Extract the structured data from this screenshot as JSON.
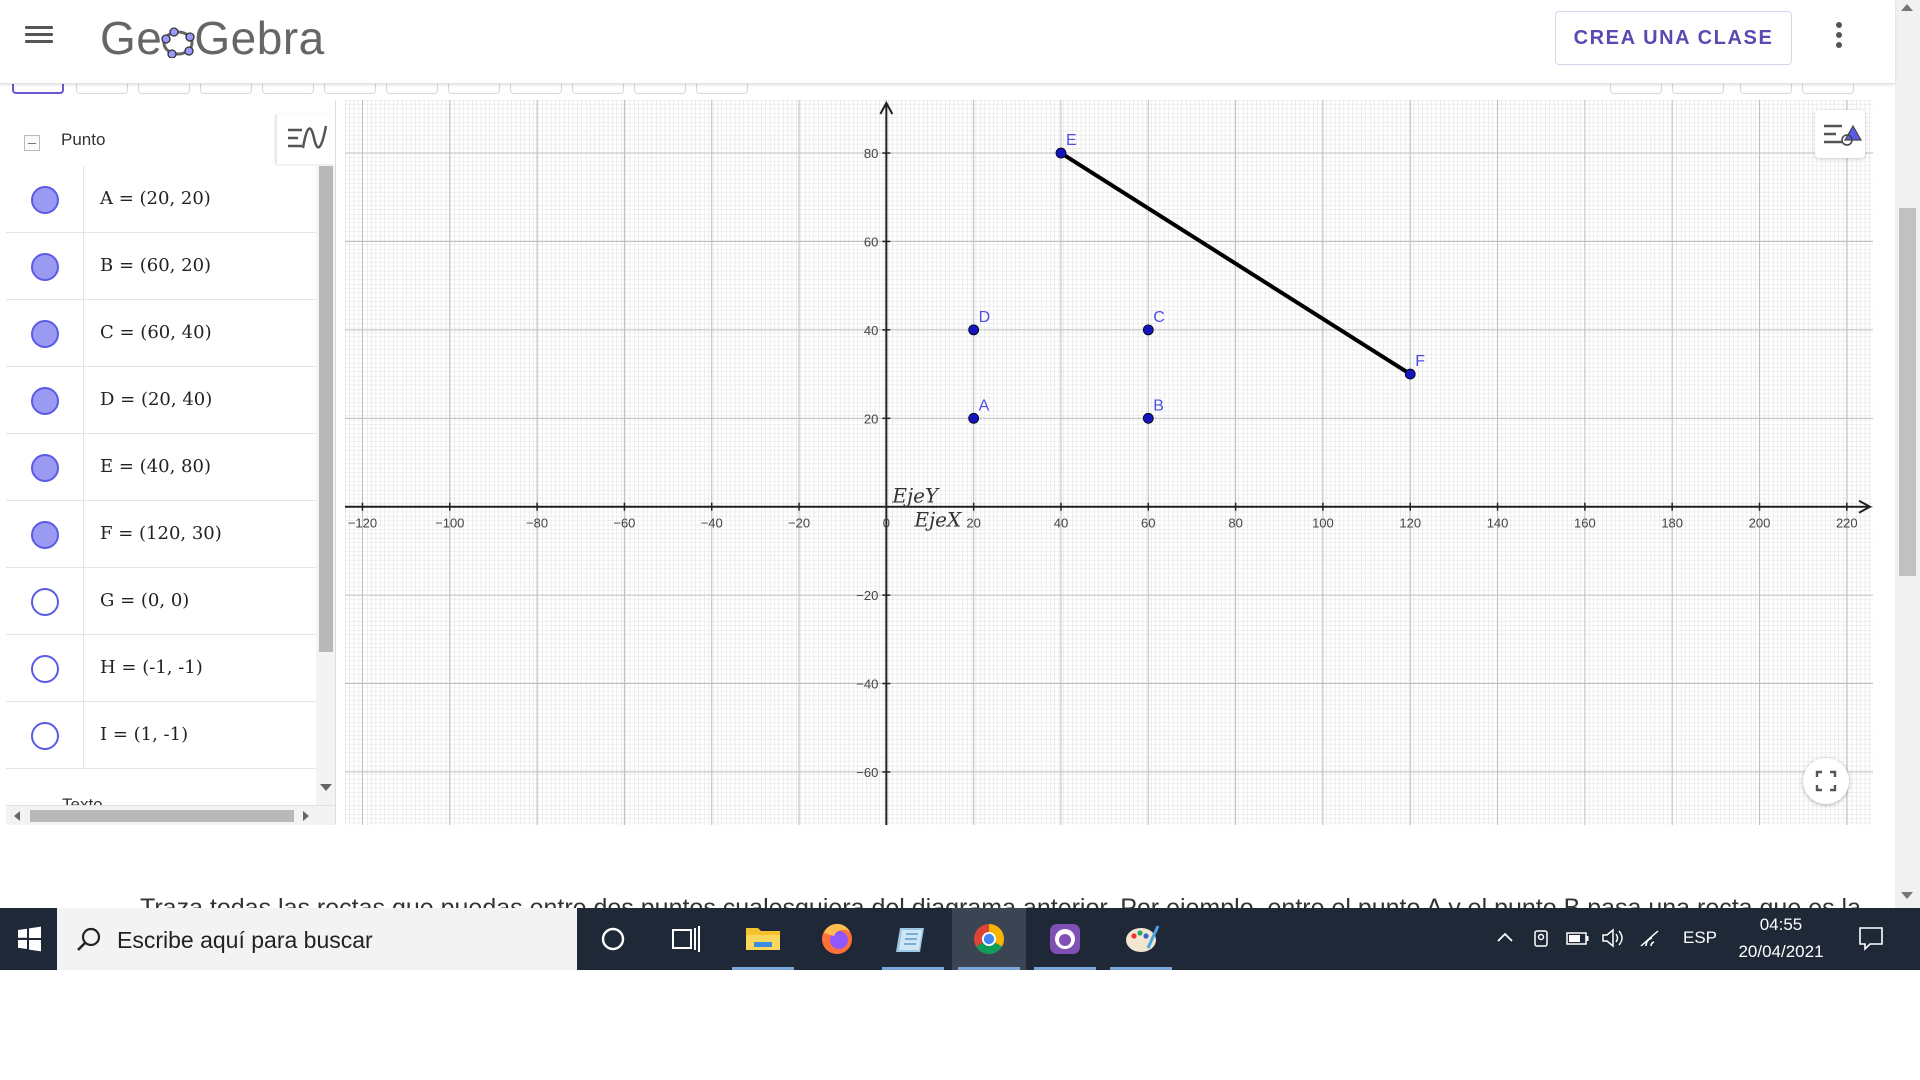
{
  "header": {
    "logo_text": "GeoGebra",
    "logo_prefix": "Ge",
    "logo_suffix": "Gebra",
    "class_button_label": "CREA UNA CLASE",
    "accent_color": "#5b48b1"
  },
  "algebra": {
    "group_label": "Punto",
    "point_color": "#5b5be8",
    "items": [
      {
        "label": "A = (20, 20)",
        "visible": true
      },
      {
        "label": "B = (60, 20)",
        "visible": true
      },
      {
        "label": "C = (60, 40)",
        "visible": true
      },
      {
        "label": "D = (20, 40)",
        "visible": true
      },
      {
        "label": "E = (40, 80)",
        "visible": true
      },
      {
        "label": "F = (120, 30)",
        "visible": true
      },
      {
        "label": "G = (0, 0)",
        "visible": false
      },
      {
        "label": "H = (-1, -1)",
        "visible": false
      },
      {
        "label": "I = (1, -1)",
        "visible": false
      }
    ],
    "next_group_partial": "Texto"
  },
  "graphics": {
    "x_axis_label": "EjeX",
    "y_axis_label": "EjeY",
    "xlim": [
      -124,
      226
    ],
    "ylim": [
      -72,
      92
    ],
    "x_ticks": [
      -120,
      -100,
      -80,
      -60,
      -40,
      -20,
      0,
      20,
      40,
      60,
      80,
      100,
      120,
      140,
      160,
      180,
      200,
      220
    ],
    "y_ticks": [
      -60,
      -40,
      -20,
      20,
      40,
      60,
      80
    ],
    "points": [
      {
        "name": "A",
        "x": 20,
        "y": 20
      },
      {
        "name": "B",
        "x": 60,
        "y": 20
      },
      {
        "name": "C",
        "x": 60,
        "y": 40
      },
      {
        "name": "D",
        "x": 20,
        "y": 40
      },
      {
        "name": "E",
        "x": 40,
        "y": 80
      },
      {
        "name": "F",
        "x": 120,
        "y": 30
      }
    ],
    "segments": [
      {
        "from": "E",
        "to": "F"
      }
    ],
    "point_color": "#1515c0",
    "label_color": "#4d4de6",
    "segment_color": "#000000"
  },
  "instruction": "Traza todas las rectas que puedas entre dos puntos cualesquiera del diagrama anterior. Por ejemplo, entre el punto A y el punto B pasa una recta que es la",
  "taskbar": {
    "search_placeholder": "Escribe aquí para buscar",
    "language": "ESP",
    "time": "04:55",
    "date": "20/04/2021"
  }
}
